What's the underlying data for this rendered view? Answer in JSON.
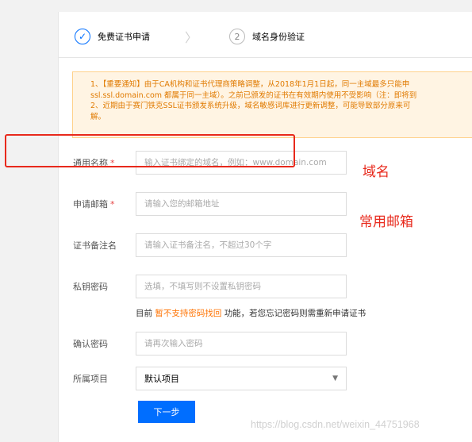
{
  "steps": [
    {
      "label": "免费证书申请",
      "state": "done",
      "icon": "check-icon"
    },
    {
      "number": "2",
      "label": "域名身份验证",
      "state": "todo"
    }
  ],
  "notice": {
    "line1": "1、【重要通知】由于CA机构和证书代理商策略调整，从2018年1月1日起，同一主域最多只能申",
    "line2": "ssl.ssl.domain.com 都属于同一主域）。之前已颁发的证书在有效期内使用不受影响（注：即将到",
    "line3": "2、近期由于赛门铁克SSL证书颁发系统升级，域名敏感词库进行更新调整，可能导致部分原来可",
    "line4": "解。"
  },
  "form": {
    "domain": {
      "label": "通用名称",
      "required_mark": "*",
      "placeholder": "输入证书绑定的域名，例如：www.domain.com"
    },
    "email": {
      "label": "申请邮箱",
      "required_mark": "*",
      "placeholder": "请输入您的邮箱地址"
    },
    "remark": {
      "label": "证书备注名",
      "placeholder": "请输入证书备注名，不超过30个字"
    },
    "key_password": {
      "label": "私钥密码",
      "placeholder": "选填，不填写则不设置私钥密码"
    },
    "hint": {
      "prefix": "目前",
      "highlight": "暂不支持密码找回",
      "suffix": "功能，若您忘记密码则需重新申请证书"
    },
    "confirm_password": {
      "label": "确认密码",
      "placeholder": "请再次输入密码"
    },
    "project": {
      "label": "所属项目",
      "value": "默认项目"
    }
  },
  "next_button": "下一步",
  "annotations": {
    "domain_note": "域名",
    "email_note": "常用邮箱"
  },
  "watermark": "https://blog.csdn.net/weixin_44751968",
  "colors": {
    "accent": "#006eff",
    "annotation_red": "#e8291c",
    "notice_text": "#e07a00",
    "notice_bg": "#fff4e3"
  }
}
